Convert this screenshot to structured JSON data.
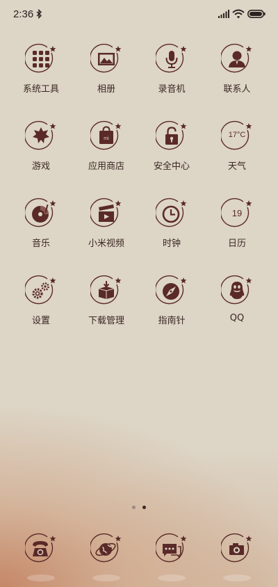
{
  "status_bar": {
    "time": "2:36"
  },
  "apps": [
    {
      "label": "系统工具",
      "icon": "tools-folder-icon"
    },
    {
      "label": "相册",
      "icon": "gallery-icon"
    },
    {
      "label": "录音机",
      "icon": "microphone-icon"
    },
    {
      "label": "联系人",
      "icon": "contacts-icon"
    },
    {
      "label": "游戏",
      "icon": "games-icon"
    },
    {
      "label": "应用商店",
      "icon": "app-store-icon"
    },
    {
      "label": "安全中心",
      "icon": "security-lock-icon"
    },
    {
      "label": "天气",
      "icon": "weather-icon",
      "icon_text": "17°C"
    },
    {
      "label": "音乐",
      "icon": "music-disc-icon"
    },
    {
      "label": "小米视频",
      "icon": "video-clapper-icon"
    },
    {
      "label": "时钟",
      "icon": "clock-icon"
    },
    {
      "label": "日历",
      "icon": "calendar-icon",
      "icon_text": "19"
    },
    {
      "label": "设置",
      "icon": "settings-gears-icon"
    },
    {
      "label": "下载管理",
      "icon": "download-box-icon"
    },
    {
      "label": "指南针",
      "icon": "compass-icon"
    },
    {
      "label": "QQ",
      "icon": "qq-penguin-icon"
    }
  ],
  "dock": [
    {
      "icon": "phone-icon"
    },
    {
      "icon": "browser-globe-icon"
    },
    {
      "icon": "messages-icon"
    },
    {
      "icon": "camera-icon"
    }
  ],
  "page_indicator": {
    "pages": 2,
    "current": 2
  },
  "colors": {
    "icon_stroke": "#5a2a28",
    "label": "#3a2723",
    "background": "#ddd5c6",
    "accent_corner": "#c48362"
  }
}
